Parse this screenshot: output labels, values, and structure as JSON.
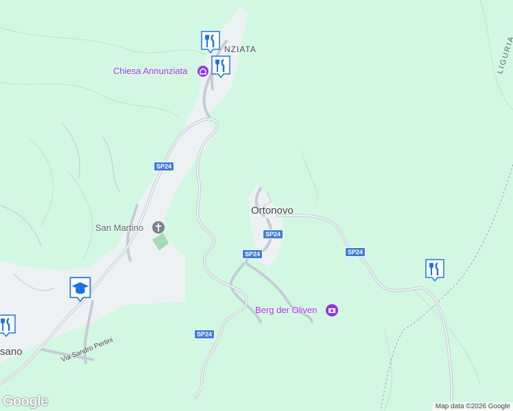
{
  "map": {
    "places": {
      "ortonovo": "Ortonovo",
      "nziata": "NZIATA",
      "liguria": "LIGURIA",
      "sano": "sano"
    },
    "pois": {
      "chiesa": "Chiesa Annunziata",
      "san_martino": "San Martino",
      "berg": "Berg der Oliven"
    },
    "streets": {
      "via_sandro_pertini": "Via Sandro Pertini",
      "shield_1": "SP24",
      "shield_2": "SP24",
      "shield_3": "SP24",
      "shield_4": "SP24",
      "shield_5": "SP24"
    },
    "icons": [
      "restaurant-icon",
      "church-icon",
      "school-icon",
      "attraction-camera-icon"
    ],
    "colors": {
      "land": "#d3f8e2",
      "urban": "#eef1f3",
      "road": "#c5ccd6",
      "poi": "#9334e6",
      "shield": "#3d7dd8",
      "marker": "#1a73e8"
    },
    "attribution": "Map data ©2026 Google",
    "logo": "Google"
  }
}
